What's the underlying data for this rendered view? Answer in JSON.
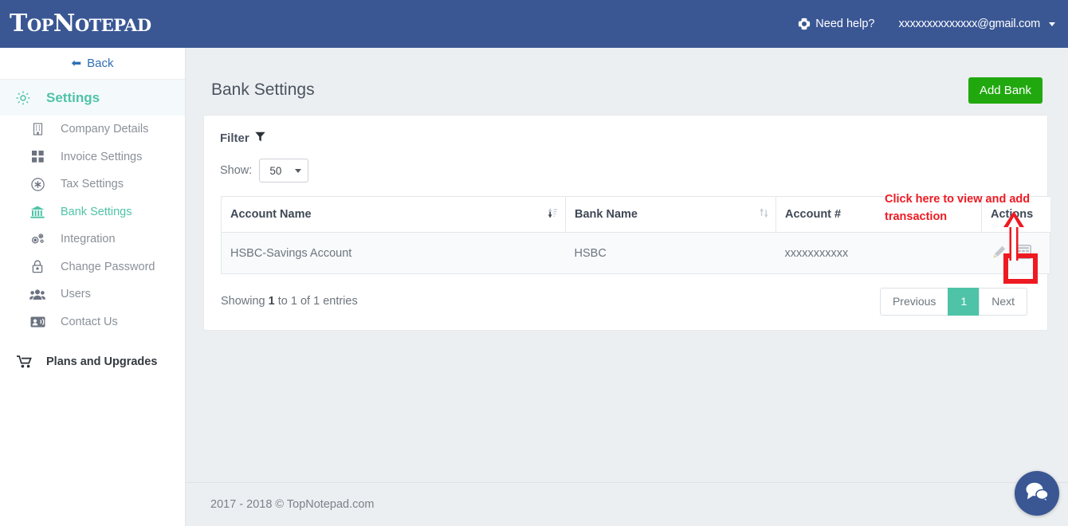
{
  "header": {
    "logo": "TopNotepad",
    "need_help_label": "Need help?",
    "need_help_icon": "life-ring-icon",
    "user_email": "xxxxxxxxxxxxxx@gmail.com",
    "caret_icon": "caret-down-icon",
    "background_color": "#3a5794"
  },
  "sidebar": {
    "back_label": "Back",
    "back_icon": "arrow-left-icon",
    "section_title": "Settings",
    "section_icon": "gear-icon",
    "accent_color": "#4ec3a7",
    "items": [
      {
        "label": "Company Details",
        "icon": "building-icon",
        "active": false
      },
      {
        "label": "Invoice Settings",
        "icon": "grid-squares-icon",
        "active": false
      },
      {
        "label": "Tax Settings",
        "icon": "asterisk-circle-icon",
        "active": false
      },
      {
        "label": "Bank Settings",
        "icon": "bank-icon",
        "active": true
      },
      {
        "label": "Integration",
        "icon": "cogs-icon",
        "active": false
      },
      {
        "label": "Change Password",
        "icon": "lock-icon",
        "active": false
      },
      {
        "label": "Users",
        "icon": "users-icon",
        "active": false
      },
      {
        "label": "Contact Us",
        "icon": "id-card-icon",
        "active": false
      }
    ],
    "bottom_item": {
      "label": "Plans and Upgrades",
      "icon": "shopping-cart-icon"
    }
  },
  "main": {
    "page_title": "Bank Settings",
    "add_button_label": "Add Bank",
    "add_button_color": "#21a80f",
    "filter_label": "Filter",
    "filter_icon": "funnel-icon",
    "show_label": "Show:",
    "show_value": "50",
    "table": {
      "columns": [
        {
          "label": "Account Name",
          "sortable": true,
          "sort_icon": "sort-asc-icon"
        },
        {
          "label": "Bank Name",
          "sortable": true,
          "sort_icon": "sort-both-icon"
        },
        {
          "label": "Account #",
          "sortable": true,
          "sort_icon": "sort-both-icon"
        },
        {
          "label": "Actions",
          "sortable": false,
          "sort_icon": ""
        }
      ],
      "rows": [
        {
          "account_name": "HSBC-Savings Account",
          "bank_name": "HSBC",
          "account_number": "xxxxxxxxxxx",
          "actions": [
            {
              "icon": "pencil-icon",
              "name": "edit-bank-icon"
            },
            {
              "icon": "table-grid-icon",
              "name": "view-transactions-icon"
            }
          ]
        }
      ]
    },
    "showing_prefix": "Showing ",
    "showing_start": "1",
    "showing_middle": " to 1 of 1 entries",
    "pagination": {
      "previous_label": "Previous",
      "pages": [
        "1"
      ],
      "next_label": "Next",
      "active_page": "1",
      "active_color": "#4ec3a7"
    }
  },
  "annotation": {
    "text": "Click here to view and add transaction",
    "color": "#ee1a22",
    "arrow_icon": "up-arrow-annotation",
    "highlight_box": "red-highlight-box"
  },
  "footer": {
    "copyright": "2017 - 2018 © TopNotepad.com"
  },
  "chat": {
    "icon": "chat-bubbles-icon",
    "color": "#3a5794"
  }
}
